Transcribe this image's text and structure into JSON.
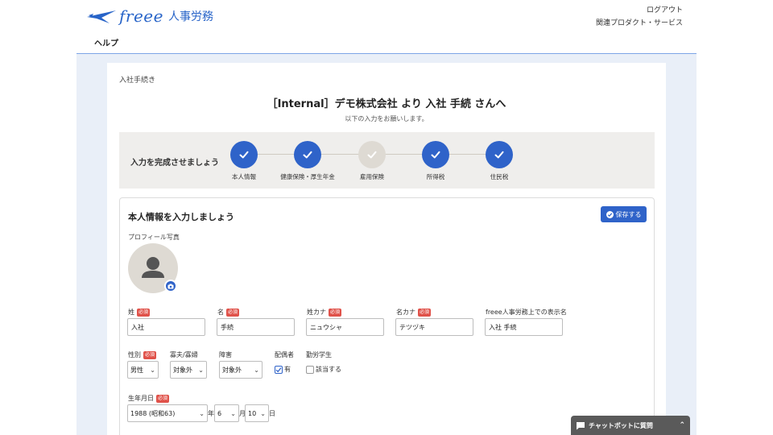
{
  "header": {
    "logo_text": "freee",
    "product": "人事労務",
    "logout": "ログアウト",
    "related": "関連プロダクト・サービス",
    "help": "ヘルプ"
  },
  "breadcrumb": "入社手続き",
  "title": "［Internal］デモ株式会社 より 入社 手続 さんへ",
  "subtitle": "以下の入力をお願いします。",
  "steps": {
    "label": "入力を完成させましょう",
    "items": [
      {
        "label": "本人情報",
        "done": true
      },
      {
        "label": "健康保険・厚生年金",
        "done": true
      },
      {
        "label": "雇用保険",
        "done": false
      },
      {
        "label": "所得税",
        "done": true
      },
      {
        "label": "住民税",
        "done": true
      }
    ]
  },
  "form": {
    "title": "本人情報を入力しましょう",
    "save": "保存する",
    "photo_label": "プロフィール写真",
    "required": "必須",
    "last_name": {
      "label": "姓",
      "value": "入社"
    },
    "first_name": {
      "label": "名",
      "value": "手続"
    },
    "last_kana": {
      "label": "姓カナ",
      "value": "ニュウシャ"
    },
    "first_kana": {
      "label": "名カナ",
      "value": "テツヅキ"
    },
    "display_name": {
      "label": "freee人事労務上での表示名",
      "value": "入社 手続"
    },
    "gender": {
      "label": "性別",
      "value": "男性"
    },
    "widow": {
      "label": "寡夫/寡婦",
      "value": "対象外"
    },
    "disability": {
      "label": "障害",
      "value": "対象外"
    },
    "spouse": {
      "label": "配偶者",
      "option": "有",
      "checked": true
    },
    "student": {
      "label": "勤労学生",
      "option": "該当する",
      "checked": false
    },
    "birth": {
      "label": "生年月日",
      "year": "1988 (昭和63)",
      "year_unit": "年",
      "month": "6",
      "month_unit": "月",
      "day": "10",
      "day_unit": "日"
    }
  },
  "chat": "チャットボットに質問",
  "colors": {
    "accent": "#2f63c9",
    "required": "#e0524a",
    "background": "#e9eff8"
  }
}
